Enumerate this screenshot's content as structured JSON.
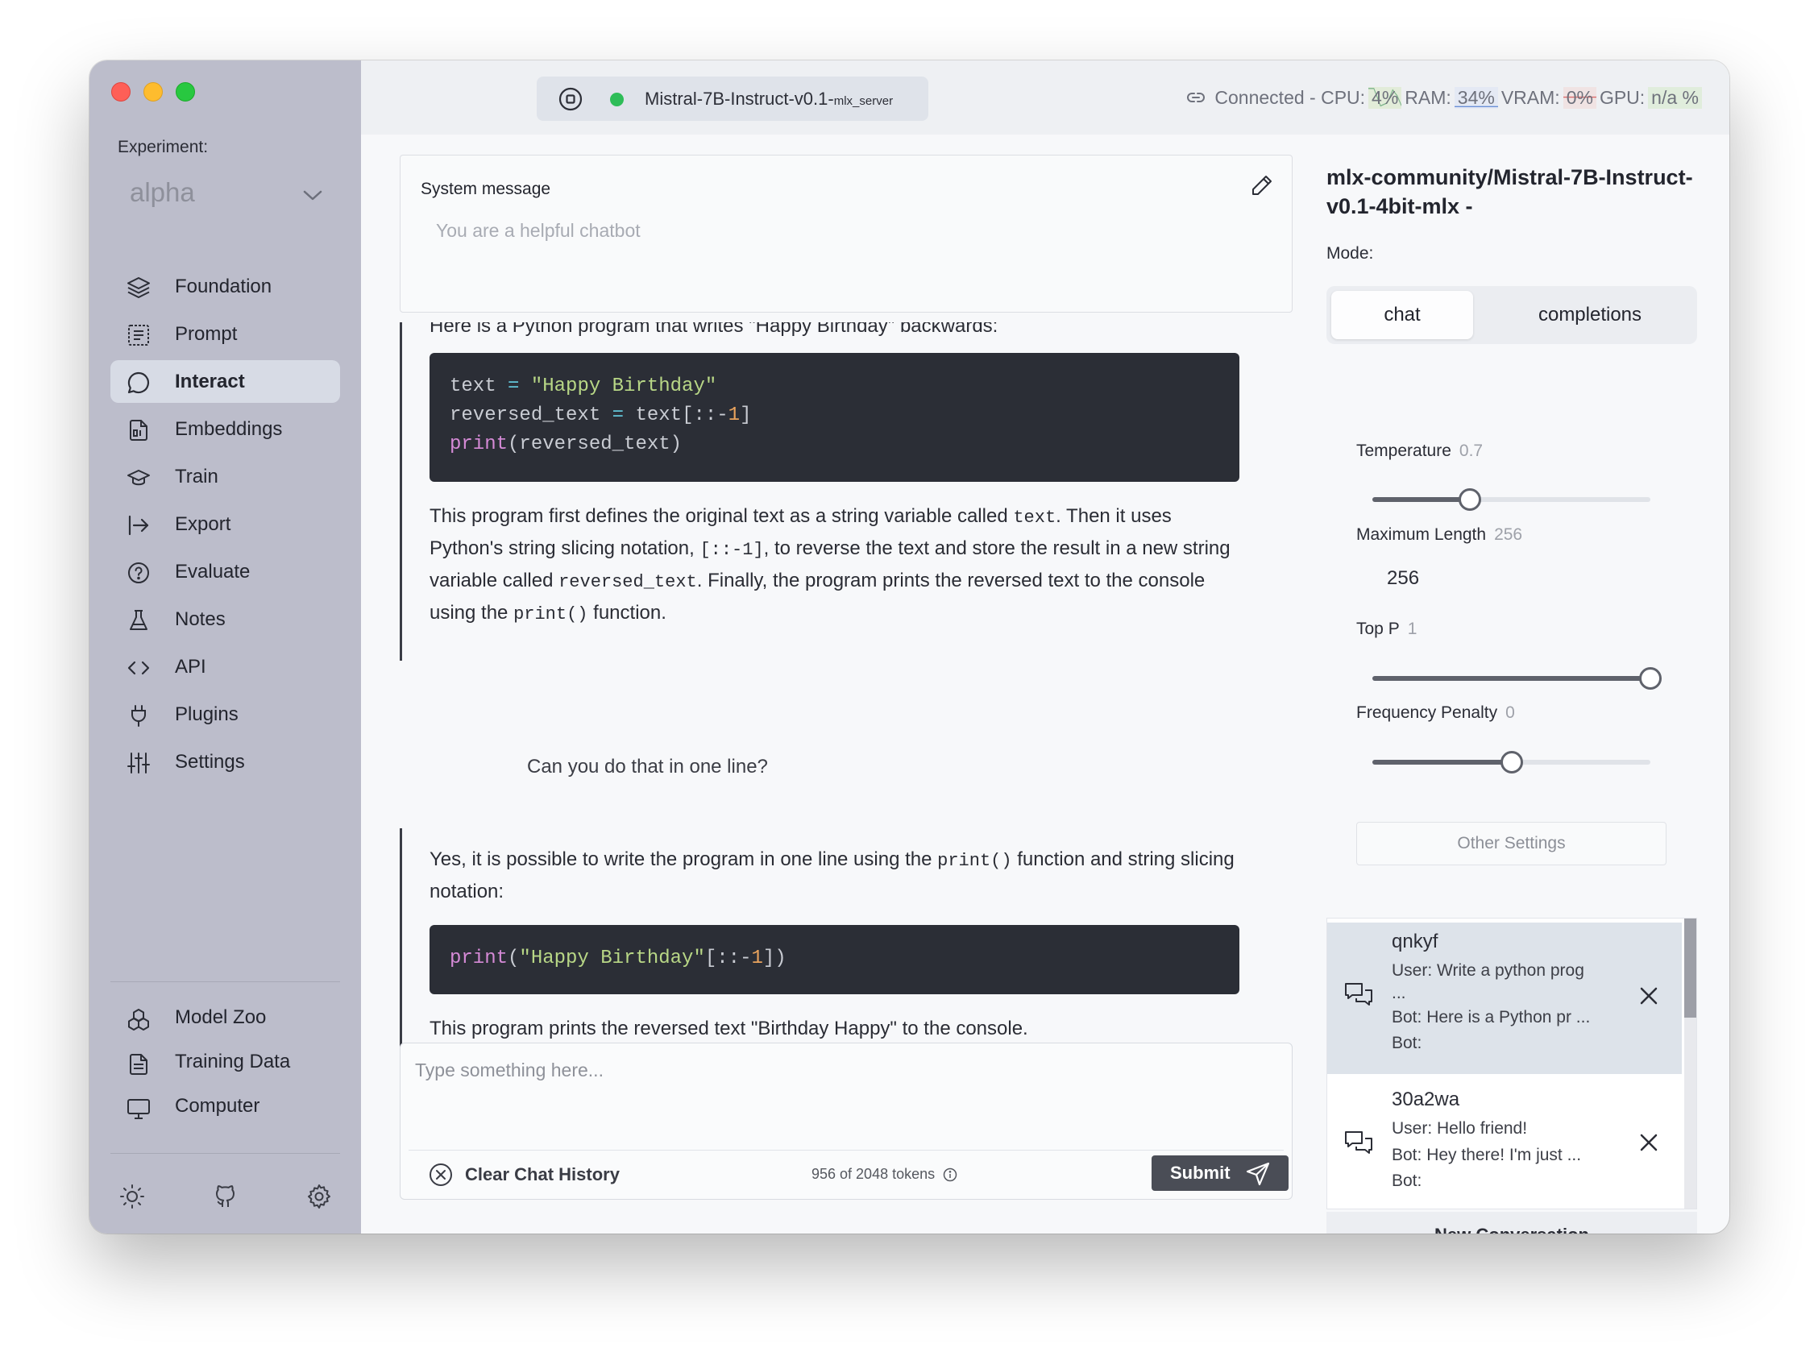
{
  "sidebar": {
    "experiment_label": "Experiment:",
    "experiment_value": "alpha",
    "items": [
      {
        "label": "Foundation",
        "icon": "layers-icon"
      },
      {
        "label": "Prompt",
        "icon": "prompt-icon"
      },
      {
        "label": "Interact",
        "icon": "chat-icon",
        "active": true
      },
      {
        "label": "Embeddings",
        "icon": "embeddings-icon"
      },
      {
        "label": "Train",
        "icon": "graduation-cap-icon"
      },
      {
        "label": "Export",
        "icon": "export-icon"
      },
      {
        "label": "Evaluate",
        "icon": "help-circle-icon"
      },
      {
        "label": "Notes",
        "icon": "flask-icon"
      },
      {
        "label": "API",
        "icon": "code-icon"
      },
      {
        "label": "Plugins",
        "icon": "plug-icon"
      },
      {
        "label": "Settings",
        "icon": "sliders-icon"
      }
    ],
    "bottom_items": [
      {
        "label": "Model Zoo",
        "icon": "model-zoo-icon"
      },
      {
        "label": "Training Data",
        "icon": "document-icon"
      },
      {
        "label": "Computer",
        "icon": "monitor-icon"
      }
    ],
    "footer_icons": [
      "sun-icon",
      "github-icon",
      "gear-icon"
    ]
  },
  "topbar": {
    "model_name": "Mistral-7B-Instruct-v0.1-",
    "model_server": "mlx_server",
    "connection_text": "Connected - CPU:",
    "cpu": "4%",
    "ram_label": "RAM:",
    "ram": "34%",
    "vram_label": "VRAM:",
    "vram": "0%",
    "gpu_label": "GPU:",
    "gpu": "n/a %",
    "status_color": "#2ebd58"
  },
  "system_message": {
    "title": "System message",
    "placeholder": "You are a helpful chatbot"
  },
  "chat": {
    "msg1_intro": "Here is a Python program that writes \"Happy Birthday\" backwards:",
    "msg1_code": {
      "l1_var": "text",
      "l1_eq": " = ",
      "l1_str": "\"Happy Birthday\"",
      "l2_var": "reversed_text",
      "l2_eq": " = ",
      "l2_rest": "text[::-",
      "l2_num": "1",
      "l2_end": "]",
      "l3_kw": "print",
      "l3_rest": "(reversed_text)"
    },
    "msg1_para": {
      "p1": "This program first defines the original text as a string variable called ",
      "c1": "text",
      "p2": ". Then it uses Python's string slicing notation, ",
      "c2": "[::-1]",
      "p3": ", to reverse the text and store the result in a new string variable called ",
      "c3": "reversed_text",
      "p4": ". Finally, the program prints the reversed text to the console using the ",
      "c4": "print()",
      "p5": " function."
    },
    "user_msg": "Can you do that in one line?",
    "msg2_para": {
      "p1": "Yes, it is possible to write the program in one line using the ",
      "c1": "print()",
      "p2": " function and string slicing notation:"
    },
    "msg2_code": {
      "kw": "print",
      "open": "(",
      "str": "\"Happy Birthday\"",
      "rest": "[::-",
      "num": "1",
      "end": "])"
    },
    "msg2_outro": "This program prints the reversed text \"Birthday Happy\" to the console."
  },
  "input": {
    "placeholder": "Type something here...",
    "clear_label": "Clear Chat History",
    "tokens": "956 of 2048 tokens",
    "submit_label": "Submit"
  },
  "right_panel": {
    "model_title": "mlx-community/Mistral-7B-Instruct-v0.1-4bit-mlx -",
    "mode_label": "Mode:",
    "modes": [
      "chat",
      "completions"
    ],
    "active_mode": "chat",
    "temperature_label": "Temperature",
    "temperature_value": "0.7",
    "temperature_fraction": 0.35,
    "max_length_label": "Maximum Length",
    "max_length_value": "256",
    "max_length_input": "256",
    "top_p_label": "Top P",
    "top_p_value": "1",
    "top_p_fraction": 1.0,
    "freq_label": "Frequency Penalty",
    "freq_value": "0",
    "freq_fraction": 0.5,
    "other_settings": "Other Settings",
    "conversations": [
      {
        "name": "qnkyf",
        "user": "User:  Write a python prog",
        "cont": "...",
        "bot": "Bot:  Here is a Python pr ...",
        "bot2": "Bot:"
      },
      {
        "name": "30a2wa",
        "user": "User:  Hello friend!",
        "bot": "Bot:  Hey there! I'm just ...",
        "bot2": "Bot:"
      }
    ],
    "new_conversation": "New Conversation"
  }
}
